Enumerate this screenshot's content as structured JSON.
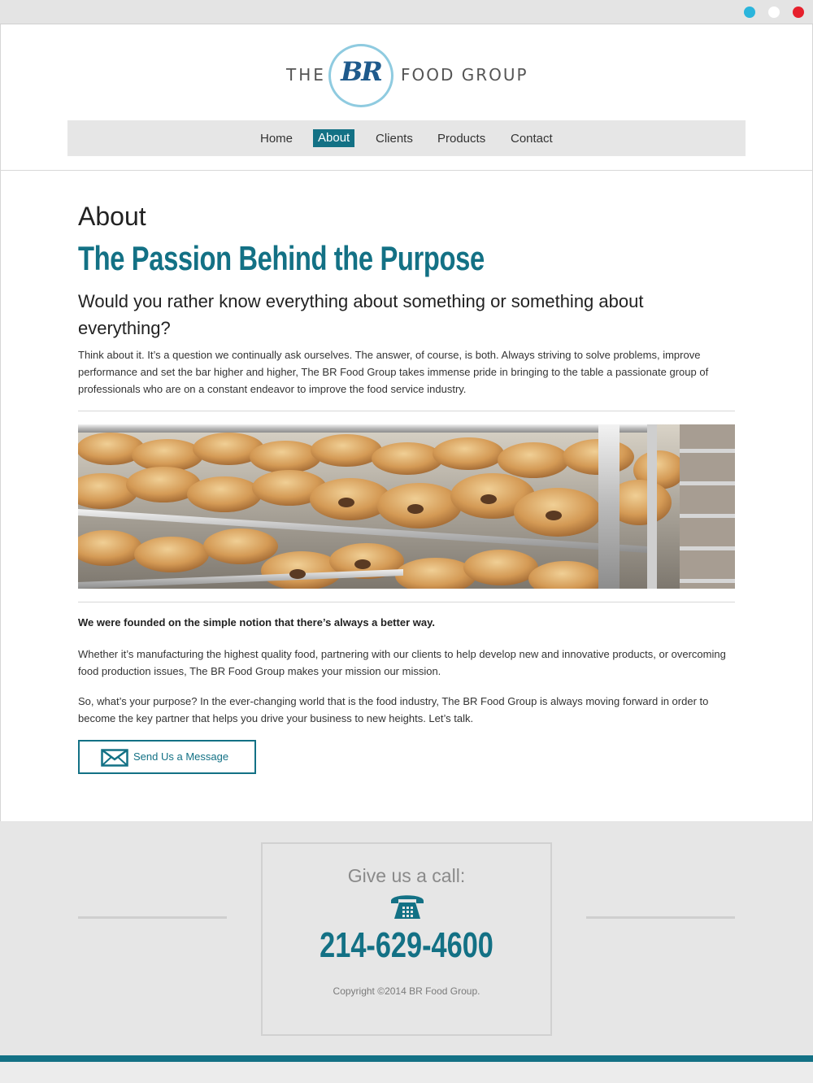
{
  "brand": {
    "the": "THE",
    "br": "BR",
    "food_group": "FOOD GROUP"
  },
  "nav": {
    "items": [
      {
        "label": "Home"
      },
      {
        "label": "About"
      },
      {
        "label": "Clients"
      },
      {
        "label": "Products"
      },
      {
        "label": "Contact"
      }
    ],
    "active": "About"
  },
  "content": {
    "title": "About",
    "tagline": "The Passion Behind the Purpose",
    "question": "Would you rather know everything about something or something about everything?",
    "intro": "Think about it. It’s a question we continually ask ourselves. The answer, of course, is both. Always striving to solve problems, improve performance and set the bar higher and higher, The BR Food Group takes immense pride in bringing to the table a passionate group of professionals who are on a constant endeavor to improve the food service industry.",
    "founded": "We were founded on the simple notion that there’s always a better way.",
    "para1": "Whether it’s manufacturing the highest quality food, partnering with our clients to help develop new and innovative products, or overcoming food production issues, The BR Food Group makes your mission our mission.",
    "para2": "So, what’s your purpose? In the ever-changing world that is the food industry, The BR Food Group is always moving forward in order to become the key partner that helps you drive your business to new heights. Let’s talk.",
    "message_button": "Send Us a Message"
  },
  "footer": {
    "call_title": "Give us a call:",
    "phone": "214-629-4600",
    "copyright": "Copyright ©2014 BR Food Group."
  },
  "colors": {
    "accent": "#137185",
    "logo_ring": "#8fcbe0",
    "footer_bg": "#e6e6e6"
  },
  "icons": {
    "message": "envelope-icon",
    "phone": "telephone-icon"
  }
}
